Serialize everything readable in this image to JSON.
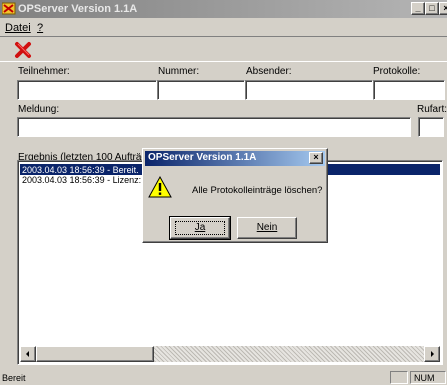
{
  "window": {
    "title": "OPServer Version 1.1A",
    "controls": [
      "_",
      "□",
      "×"
    ]
  },
  "menu": {
    "items": [
      {
        "label": "Datei"
      },
      {
        "label": "?"
      }
    ]
  },
  "toolbar": {
    "delete_icon": "red-x-icon"
  },
  "form": {
    "teilnehmer_label": "Teilnehmer:",
    "nummer_label": "Nummer:",
    "absender_label": "Absender:",
    "protokolle_label": "Protokolle:",
    "meldung_label": "Meldung:",
    "rufart_label": "Rufart:",
    "teilnehmer_value": "",
    "nummer_value": "",
    "absender_value": "",
    "protokolle_value": "",
    "meldung_value": "",
    "rufart_value": ""
  },
  "results": {
    "label": "Ergebnis (letzten 100 Aufträge",
    "rows": [
      {
        "text": "2003.04.03 18:56:39 - Bereit.",
        "selected": true
      },
      {
        "text": "2003.04.03 18:56:39 - Lizenz:",
        "selected": false
      }
    ]
  },
  "status": {
    "text": "Bereit",
    "num": "NUM"
  },
  "dialog": {
    "title": "OPServer Version 1.1A",
    "message": "Alle Protokolleinträge löschen?",
    "yes_label": "Ja",
    "no_label": "Nein",
    "icon": "warning-icon"
  },
  "colors": {
    "selection": "#0a246a",
    "dialog_title": "#0a246a",
    "face": "#d4d0c8"
  }
}
